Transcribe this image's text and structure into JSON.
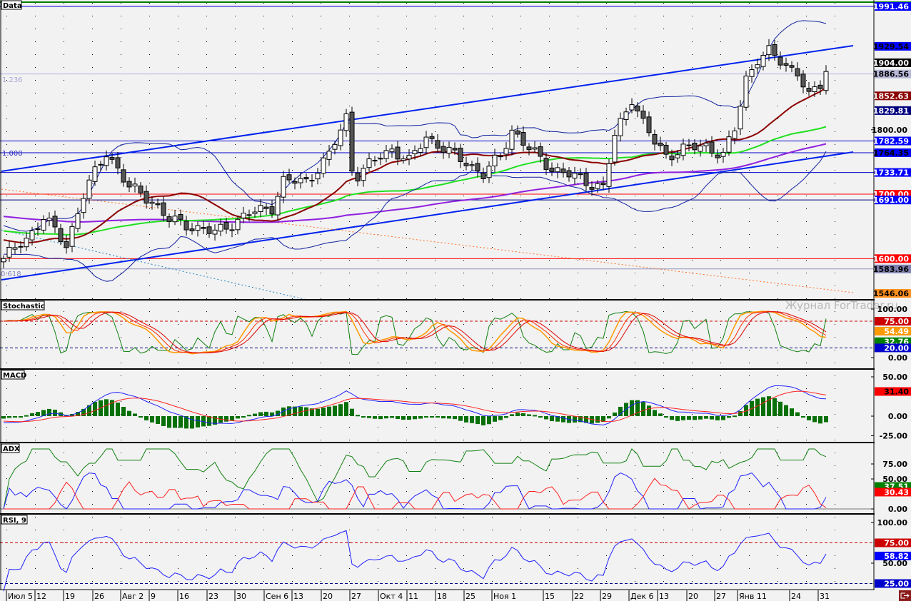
{
  "panels": {
    "main_title": "Data",
    "stoch_title": "Stochastic",
    "macd_title": "MACD",
    "adx_title": "ADX",
    "rsi_title": "RSI, 9"
  },
  "watermark": "Журнал ForTrader.ru",
  "fib_labels": {
    "f1236": "1.236",
    "f1000": "1.000",
    "f0618": "0.618"
  },
  "dates": [
    "Июл 5",
    "12",
    "19",
    "26",
    "Авг 2",
    "9",
    "16",
    "23",
    "30",
    "Сен 6",
    "13",
    "20",
    "27",
    "Окт 4",
    "11",
    "18",
    "25",
    "Ноя 1",
    "15",
    "22",
    "29",
    "Дек 6",
    "13",
    "20",
    "27",
    "Янв 11",
    "24",
    "31"
  ],
  "chart_data": {
    "type": "candlestick",
    "price_range": [
      1546.06,
      1991.46
    ],
    "price_anchors": [
      [
        0,
        1600
      ],
      [
        4,
        1630
      ],
      [
        7,
        1665
      ],
      [
        11,
        1620
      ],
      [
        14,
        1700
      ],
      [
        18,
        1765
      ],
      [
        20,
        1740
      ],
      [
        22,
        1710
      ],
      [
        26,
        1690
      ],
      [
        29,
        1660
      ],
      [
        33,
        1650
      ],
      [
        37,
        1640
      ],
      [
        41,
        1660
      ],
      [
        43,
        1670
      ],
      [
        47,
        1680
      ],
      [
        49,
        1720
      ],
      [
        53,
        1720
      ],
      [
        57,
        1760
      ],
      [
        59,
        1800
      ],
      [
        60,
        1820
      ],
      [
        61,
        1740
      ],
      [
        62,
        1730
      ],
      [
        66,
        1760
      ],
      [
        68,
        1770
      ],
      [
        71,
        1750
      ],
      [
        74,
        1790
      ],
      [
        77,
        1770
      ],
      [
        81,
        1750
      ],
      [
        84,
        1730
      ],
      [
        87,
        1760
      ],
      [
        89,
        1800
      ],
      [
        92,
        1770
      ],
      [
        96,
        1740
      ],
      [
        99,
        1730
      ],
      [
        102,
        1720
      ],
      [
        105,
        1710
      ],
      [
        107,
        1790
      ],
      [
        110,
        1850
      ],
      [
        112,
        1810
      ],
      [
        114,
        1780
      ],
      [
        116,
        1760
      ],
      [
        119,
        1770
      ],
      [
        123,
        1775
      ],
      [
        126,
        1760
      ],
      [
        128,
        1800
      ],
      [
        130,
        1880
      ],
      [
        132,
        1910
      ],
      [
        134,
        1920
      ],
      [
        137,
        1900
      ],
      [
        139,
        1890
      ],
      [
        141,
        1850
      ],
      [
        143,
        1870
      ],
      [
        144,
        1895
      ]
    ],
    "price_ticks": [
      "1800.00"
    ],
    "price_labels": [
      {
        "text": "1991.46",
        "value": 1991.46,
        "bg": "#0000ff",
        "fg": "#ffffff",
        "line": "#0000cc"
      },
      {
        "text": "1929.54",
        "value": 1929.54,
        "bg": "#0000ff",
        "fg": "#000000"
      },
      {
        "text": "1904.00",
        "value": 1904.0,
        "bg": "#000000",
        "fg": "#ffffff"
      },
      {
        "text": "1886.56",
        "value": 1886.56,
        "bg": "#b8b8d8",
        "fg": "#000000",
        "line": "#b0b0e8"
      },
      {
        "text": "1852.63",
        "value": 1852.63,
        "bg": "#8b0000",
        "fg": "#ffffff"
      },
      {
        "text": "1829.81",
        "value": 1829.81,
        "bg": "#000080",
        "fg": "#ffffff"
      },
      {
        "text": "1782.59",
        "value": 1782.59,
        "bg": "#0000ff",
        "fg": "#ffffff",
        "line": "#0000cc"
      },
      {
        "text": "1764.35",
        "value": 1764.35,
        "bg": "#0000ff",
        "fg": "#000000",
        "line": "#0000cc"
      },
      {
        "text": "1733.71",
        "value": 1733.71,
        "bg": "#0000ff",
        "fg": "#ffffff",
        "line": "#0000cc"
      },
      {
        "text": "1700.00",
        "value": 1700.0,
        "bg": "#ff0000",
        "fg": "#ffffff",
        "line": "#ff0000"
      },
      {
        "text": "1691.00",
        "value": 1691.0,
        "bg": "#0000ff",
        "fg": "#ffffff",
        "line": "#000080"
      },
      {
        "text": "1600.00",
        "value": 1600.0,
        "bg": "#ff0000",
        "fg": "#ffffff",
        "line": "#ff0000"
      },
      {
        "text": "1583.96",
        "value": 1583.96,
        "bg": "#8080b0",
        "fg": "#000000",
        "line": "#9090c0"
      },
      {
        "text": "1546.06",
        "value": 1546.06,
        "bg": "#ff9020",
        "fg": "#000000"
      }
    ],
    "stochastic": {
      "levels": [
        75,
        20
      ],
      "ticks": [
        "100.00",
        "0.00"
      ],
      "labels": [
        {
          "text": "75.00",
          "value": 75,
          "bg": "#cc0000",
          "fg": "#ffffff"
        },
        {
          "text": "54.49",
          "value": 54.49,
          "bg": "#ff9900",
          "fg": "#ffffff"
        },
        {
          "text": "32.76",
          "value": 32.76,
          "bg": "#008000",
          "fg": "#ffffff"
        },
        {
          "text": "20.00",
          "value": 20,
          "bg": "#0000cc",
          "fg": "#ffffff"
        }
      ]
    },
    "macd": {
      "ticks": [
        {
          "text": "50.00",
          "value": 50
        },
        {
          "text": "0.00",
          "value": 0
        },
        {
          "text": "-25.00",
          "value": -25
        }
      ],
      "labels": [
        {
          "text": "31.40",
          "value": 31.4,
          "bg": "#ff0000",
          "fg": "#000000"
        }
      ]
    },
    "adx": {
      "ticks": [
        {
          "text": "75.00",
          "value": 75
        },
        {
          "text": "50.00",
          "value": 50
        },
        {
          "text": "0.00",
          "value": 0
        }
      ],
      "labels": [
        {
          "text": "37.51",
          "value": 37.51,
          "bg": "#008000",
          "fg": "#ffffff"
        },
        {
          "text": "30.43",
          "value": 30.43,
          "bg": "#ff0000",
          "fg": "#ffffff"
        }
      ]
    },
    "rsi": {
      "period": 9,
      "levels": [
        75,
        25
      ],
      "ticks": [
        {
          "text": "100.00",
          "value": 100
        },
        {
          "text": "50.00",
          "value": 50
        }
      ],
      "labels": [
        {
          "text": "75.00",
          "value": 75,
          "bg": "#cc0000",
          "fg": "#ffffff"
        },
        {
          "text": "58.82",
          "value": 58.82,
          "bg": "#0000ff",
          "fg": "#ffffff"
        },
        {
          "text": "25.00",
          "value": 25,
          "bg": "#0000cc",
          "fg": "#ffffff"
        }
      ]
    }
  }
}
